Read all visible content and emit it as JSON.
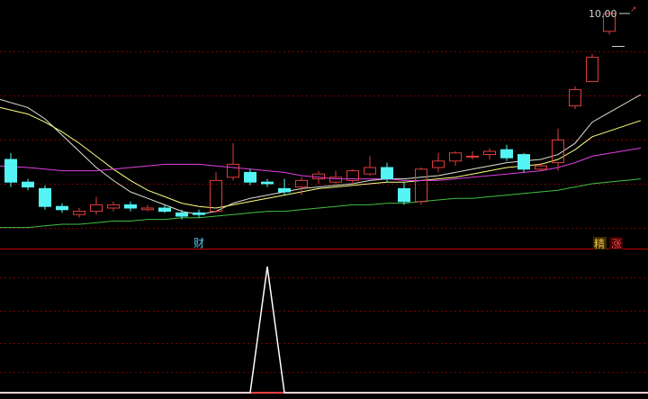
{
  "price_label": "10.00",
  "markers": {
    "cai": "财",
    "jing": "精",
    "zhang": "涨"
  },
  "colors": {
    "background": "#000000",
    "grid": "#7a0000",
    "separator": "#c00000",
    "up_candle": "#e03c3c",
    "down_candle": "#54f4f4",
    "ma_white": "#e0e0d0",
    "ma_yellow": "#ffff80",
    "ma_magenta": "#e040e0",
    "ma_green": "#40c040",
    "indicator": "#ffffff"
  },
  "candles": [
    {
      "o": 9.1,
      "h": 9.14,
      "l": 8.93,
      "c": 8.96
    },
    {
      "o": 8.96,
      "h": 8.98,
      "l": 8.91,
      "c": 8.93
    },
    {
      "o": 8.92,
      "h": 8.94,
      "l": 8.79,
      "c": 8.81
    },
    {
      "o": 8.81,
      "h": 8.83,
      "l": 8.77,
      "c": 8.79
    },
    {
      "o": 8.76,
      "h": 8.8,
      "l": 8.74,
      "c": 8.78
    },
    {
      "o": 8.78,
      "h": 8.87,
      "l": 8.76,
      "c": 8.82
    },
    {
      "o": 8.8,
      "h": 8.84,
      "l": 8.78,
      "c": 8.82
    },
    {
      "o": 8.82,
      "h": 8.84,
      "l": 8.78,
      "c": 8.8
    },
    {
      "o": 8.79,
      "h": 8.82,
      "l": 8.78,
      "c": 8.8
    },
    {
      "o": 8.8,
      "h": 8.82,
      "l": 8.77,
      "c": 8.78
    },
    {
      "o": 8.77,
      "h": 8.79,
      "l": 8.73,
      "c": 8.75
    },
    {
      "o": 8.77,
      "h": 8.79,
      "l": 8.74,
      "c": 8.76
    },
    {
      "o": 8.78,
      "h": 9.02,
      "l": 8.77,
      "c": 8.97
    },
    {
      "o": 8.99,
      "h": 9.2,
      "l": 8.97,
      "c": 9.07
    },
    {
      "o": 9.02,
      "h": 9.04,
      "l": 8.94,
      "c": 8.96
    },
    {
      "o": 8.96,
      "h": 8.98,
      "l": 8.93,
      "c": 8.95
    },
    {
      "o": 8.92,
      "h": 8.98,
      "l": 8.88,
      "c": 8.9
    },
    {
      "o": 8.93,
      "h": 8.99,
      "l": 8.88,
      "c": 8.97
    },
    {
      "o": 8.98,
      "h": 9.03,
      "l": 8.95,
      "c": 9.01
    },
    {
      "o": 8.96,
      "h": 9.03,
      "l": 8.95,
      "c": 8.99
    },
    {
      "o": 8.97,
      "h": 9.04,
      "l": 8.95,
      "c": 9.03
    },
    {
      "o": 9.01,
      "h": 9.12,
      "l": 9.0,
      "c": 9.05
    },
    {
      "o": 9.05,
      "h": 9.08,
      "l": 8.96,
      "c": 8.98
    },
    {
      "o": 8.92,
      "h": 8.96,
      "l": 8.82,
      "c": 8.84
    },
    {
      "o": 8.84,
      "h": 9.05,
      "l": 8.82,
      "c": 9.04
    },
    {
      "o": 9.05,
      "h": 9.14,
      "l": 9.02,
      "c": 9.09
    },
    {
      "o": 9.09,
      "h": 9.15,
      "l": 9.06,
      "c": 9.14
    },
    {
      "o": 9.12,
      "h": 9.15,
      "l": 9.1,
      "c": 9.12
    },
    {
      "o": 9.13,
      "h": 9.17,
      "l": 9.1,
      "c": 9.15
    },
    {
      "o": 9.16,
      "h": 9.19,
      "l": 9.09,
      "c": 9.11
    },
    {
      "o": 9.13,
      "h": 9.14,
      "l": 9.02,
      "c": 9.04
    },
    {
      "o": 9.04,
      "h": 9.08,
      "l": 9.03,
      "c": 9.06
    },
    {
      "o": 9.08,
      "h": 9.29,
      "l": 9.03,
      "c": 9.22
    },
    {
      "o": 9.43,
      "h": 9.55,
      "l": 9.41,
      "c": 9.53
    },
    {
      "o": 9.58,
      "h": 9.75,
      "l": 9.58,
      "c": 9.73
    },
    {
      "o": 9.89,
      "h": 10.0,
      "l": 9.87,
      "c": 10.0
    }
  ],
  "ma_lines": {
    "white": [
      9.47,
      9.42,
      9.35,
      9.25,
      9.15,
      9.05,
      8.97,
      8.9,
      8.86,
      8.82,
      8.78,
      8.76,
      8.78,
      8.83,
      8.86,
      8.88,
      8.9,
      8.92,
      8.93,
      8.94,
      8.95,
      8.97,
      8.98,
      8.98,
      8.99,
      9.0,
      9.02,
      9.04,
      9.06,
      9.08,
      9.09,
      9.1,
      9.13,
      9.2,
      9.33,
      9.5
    ],
    "yellow": [
      9.42,
      9.38,
      9.33,
      9.27,
      9.2,
      9.12,
      9.04,
      8.97,
      8.91,
      8.87,
      8.83,
      8.81,
      8.8,
      8.82,
      8.84,
      8.86,
      8.88,
      8.9,
      8.92,
      8.93,
      8.94,
      8.95,
      8.96,
      8.96,
      8.97,
      8.98,
      8.99,
      9.01,
      9.03,
      9.05,
      9.06,
      9.07,
      9.1,
      9.16,
      9.24,
      9.34
    ],
    "magenta": [
      9.06,
      9.05,
      9.04,
      9.03,
      9.03,
      9.03,
      9.04,
      9.05,
      9.06,
      9.07,
      9.07,
      9.07,
      9.06,
      9.05,
      9.04,
      9.03,
      9.02,
      9.0,
      8.99,
      8.98,
      8.98,
      8.98,
      8.98,
      8.97,
      8.97,
      8.97,
      8.98,
      8.99,
      9.0,
      9.01,
      9.02,
      9.03,
      9.05,
      9.08,
      9.12,
      9.17
    ],
    "green": [
      8.68,
      8.68,
      8.69,
      8.7,
      8.7,
      8.71,
      8.72,
      8.72,
      8.73,
      8.73,
      8.74,
      8.74,
      8.75,
      8.76,
      8.77,
      8.78,
      8.78,
      8.79,
      8.8,
      8.81,
      8.82,
      8.82,
      8.83,
      8.83,
      8.84,
      8.85,
      8.86,
      8.86,
      8.87,
      8.88,
      8.89,
      8.9,
      8.91,
      8.93,
      8.95,
      8.98
    ]
  },
  "indicator": [
    0,
    0,
    0,
    0,
    0,
    0,
    0,
    0,
    0,
    0,
    0,
    0,
    0,
    0,
    0,
    1,
    0,
    0,
    0,
    0,
    0,
    0,
    0,
    0,
    0,
    0,
    0,
    0,
    0,
    0,
    0,
    0,
    0,
    0,
    0,
    0
  ]
}
